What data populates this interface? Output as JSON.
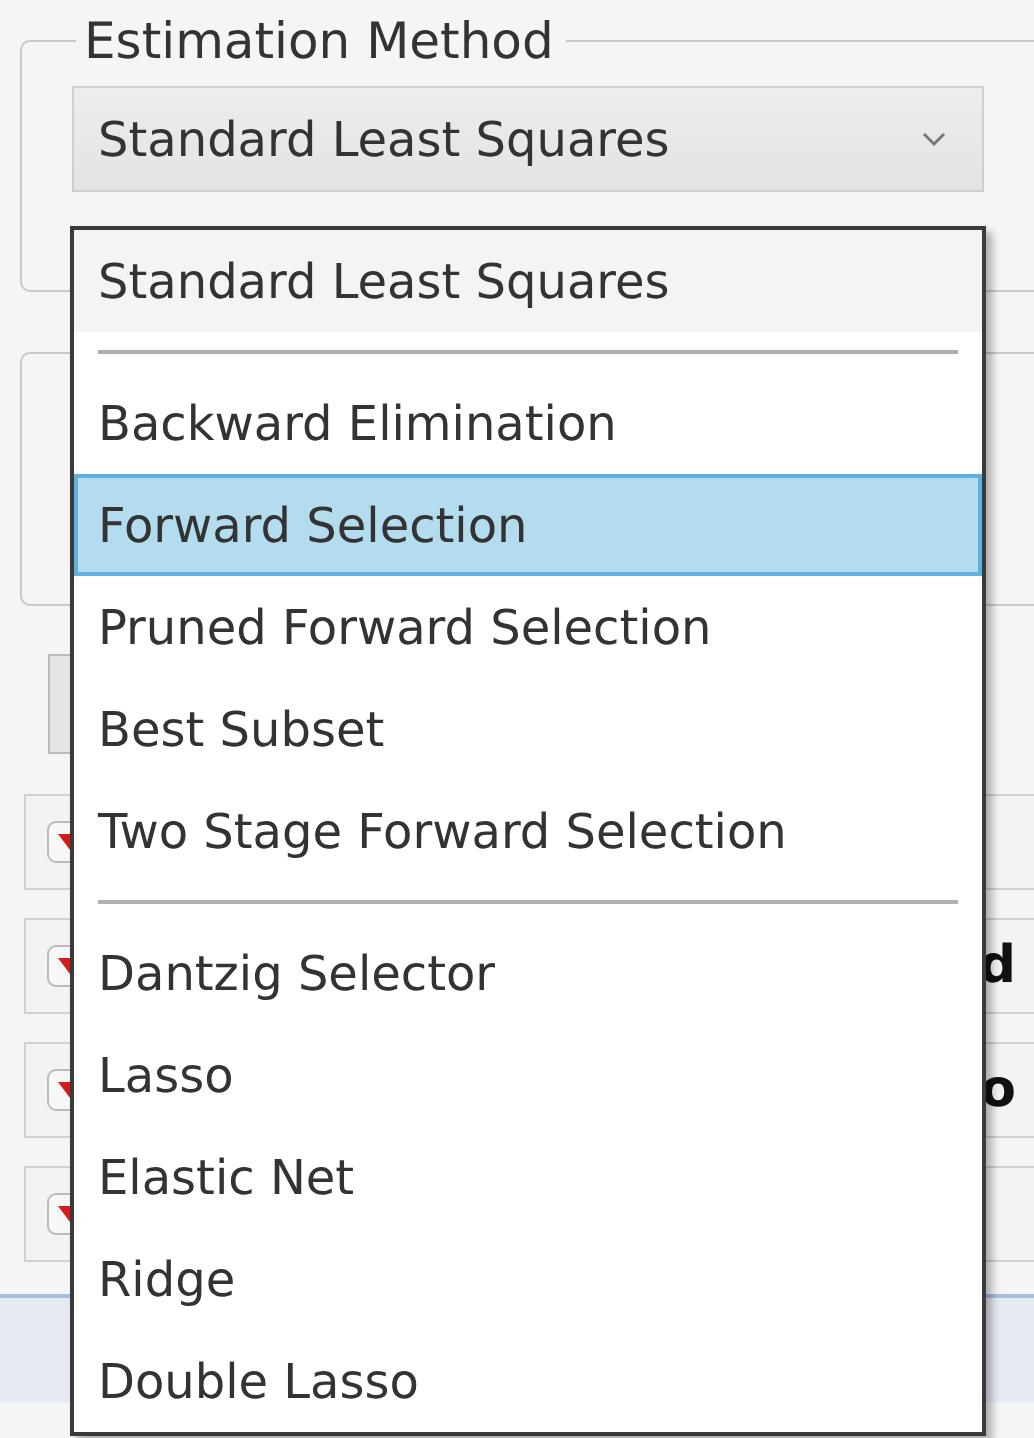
{
  "estimation_method": {
    "legend": "Estimation Method",
    "combo_value": "Standard Least Squares"
  },
  "dropdown": {
    "items": [
      {
        "kind": "option",
        "label": "Standard Least Squares",
        "selected": false
      },
      {
        "kind": "separator"
      },
      {
        "kind": "option",
        "label": "Backward Elimination",
        "selected": false
      },
      {
        "kind": "option",
        "label": "Forward Selection",
        "selected": true
      },
      {
        "kind": "option",
        "label": "Pruned Forward Selection",
        "selected": false
      },
      {
        "kind": "option",
        "label": "Best Subset",
        "selected": false
      },
      {
        "kind": "option",
        "label": "Two Stage Forward Selection",
        "selected": false
      },
      {
        "kind": "separator"
      },
      {
        "kind": "option",
        "label": "Dantzig Selector",
        "selected": false
      },
      {
        "kind": "option",
        "label": "Lasso",
        "selected": false
      },
      {
        "kind": "option",
        "label": "Elastic Net",
        "selected": false
      },
      {
        "kind": "option",
        "label": "Ridge",
        "selected": false
      },
      {
        "kind": "option",
        "label": "Double Lasso",
        "selected": false
      }
    ]
  },
  "outline_rows": [
    {
      "kind": "outline"
    },
    {
      "kind": "outline",
      "label": "d"
    },
    {
      "kind": "outline",
      "label": "o"
    },
    {
      "kind": "outline"
    }
  ]
}
